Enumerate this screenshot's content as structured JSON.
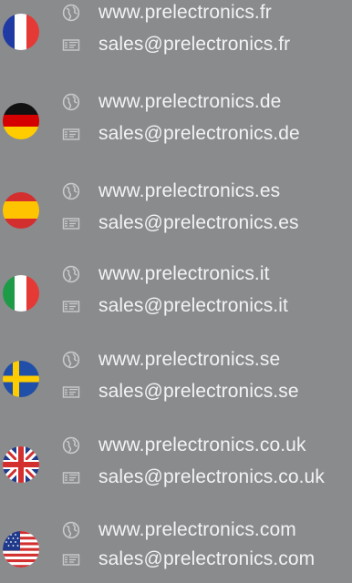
{
  "contacts": [
    {
      "country_flag": "france-flag",
      "website": "www.prelectronics.fr",
      "email": "sales@prelectronics.fr"
    },
    {
      "country_flag": "germany-flag",
      "website": "www.prelectronics.de",
      "email": "sales@prelectronics.de"
    },
    {
      "country_flag": "spain-flag",
      "website": "www.prelectronics.es",
      "email": "sales@prelectronics.es"
    },
    {
      "country_flag": "italy-flag",
      "website": "www.prelectronics.it",
      "email": "sales@prelectronics.it"
    },
    {
      "country_flag": "sweden-flag",
      "website": "www.prelectronics.se",
      "email": "sales@prelectronics.se"
    },
    {
      "country_flag": "uk-flag",
      "website": "www.prelectronics.co.uk",
      "email": "sales@prelectronics.co.uk"
    },
    {
      "country_flag": "usa-flag",
      "website": "www.prelectronics.com",
      "email": "sales@prelectronics.com"
    }
  ],
  "icons": {
    "website": "globe-icon",
    "email": "envelope-icon"
  },
  "colors": {
    "background": "#8a8b8d",
    "text": "#f2f3f4"
  }
}
